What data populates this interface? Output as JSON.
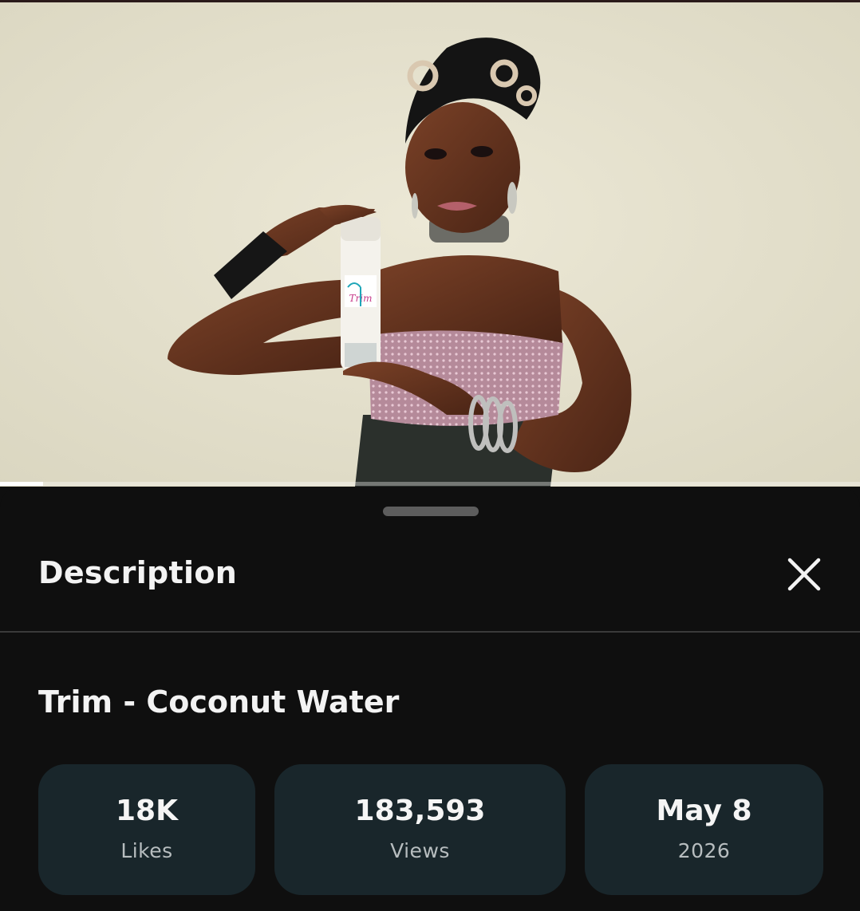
{
  "player": {
    "progress_fraction": 0.05,
    "brand_on_bottle": "Trim"
  },
  "panel": {
    "title": "Description",
    "close_icon": "close-icon",
    "video_title": "Trim - Coconut Water",
    "stats": [
      {
        "value": "18K",
        "label": "Likes"
      },
      {
        "value": "183,593",
        "label": "Views"
      },
      {
        "value": "May 8",
        "label": "2026"
      }
    ]
  },
  "colors": {
    "panel_bg": "#0f0f0f",
    "card_bg": "#19262b",
    "text": "#f3f3f3",
    "subtext": "#b7bdbf"
  }
}
